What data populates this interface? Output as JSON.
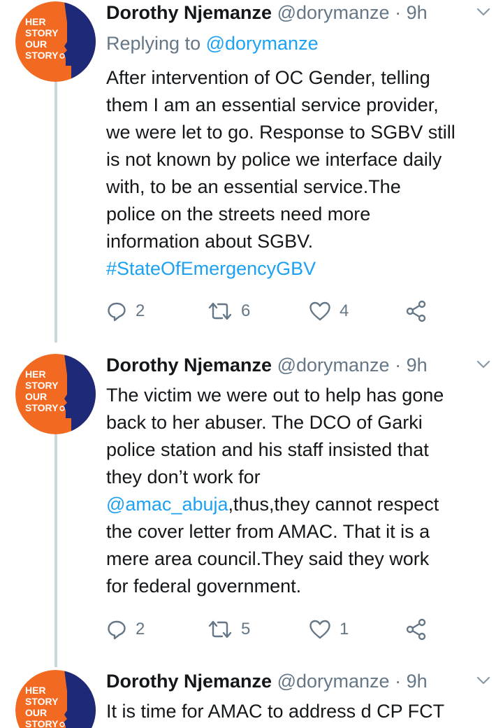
{
  "colors": {
    "avatar_orange": "#f26a21",
    "avatar_navy": "#1e2a78",
    "avatar_text": "#ffffff",
    "link_blue": "#1da1f2",
    "muted_gray": "#657786",
    "thread_line": "#ccd6dd"
  },
  "tweets": [
    {
      "author_name": "Dorothy Njemanze",
      "author_handle": "@dorymanze",
      "separator": "·",
      "time": "9h",
      "replying_prefix": "Replying to",
      "replying_handle": "@dorymanze",
      "avatar_text": [
        "HER",
        "STORY",
        "OUR",
        "STORY"
      ],
      "lines": [
        "After intervention of OC Gender, telling",
        "them I am an essential service provider,",
        "we were let to go. Response to SGBV still",
        "is not known by police we interface daily",
        "with, to be an essential service.The",
        "police on the streets need more",
        "information about SGBV."
      ],
      "hashtag": "#StateOfEmergencyGBV",
      "reply_count": "2",
      "retweet_count": "6",
      "like_count": "4",
      "icons": [
        "reply-icon",
        "retweet-icon",
        "like-icon",
        "share-icon",
        "chevron-down-icon"
      ]
    },
    {
      "author_name": "Dorothy Njemanze",
      "author_handle": "@dorymanze",
      "separator": "·",
      "time": "9h",
      "avatar_text": [
        "HER",
        "STORY",
        "OUR",
        "STORY"
      ],
      "line1": "The victim we were out to help has gone",
      "line2": "back to her abuser. The DCO of Garki",
      "line3": "police station and his staff insisted that",
      "line4": "they don’t work for",
      "mention": "@amac_abuja",
      "line5_rest": ",thus,they cannot respect",
      "line6": "the cover letter from AMAC. That it is a",
      "line7": "mere area council.They said they work",
      "line8": "for federal government.",
      "reply_count": "2",
      "retweet_count": "5",
      "like_count": "1"
    },
    {
      "author_name": "Dorothy Njemanze",
      "author_handle": "@dorymanze",
      "separator": "·",
      "time": "9h",
      "avatar_text": [
        "HER",
        "STORY",
        "OUR",
        "STORY"
      ],
      "line1": "It is time for AMAC to address d CP FCT"
    }
  ]
}
